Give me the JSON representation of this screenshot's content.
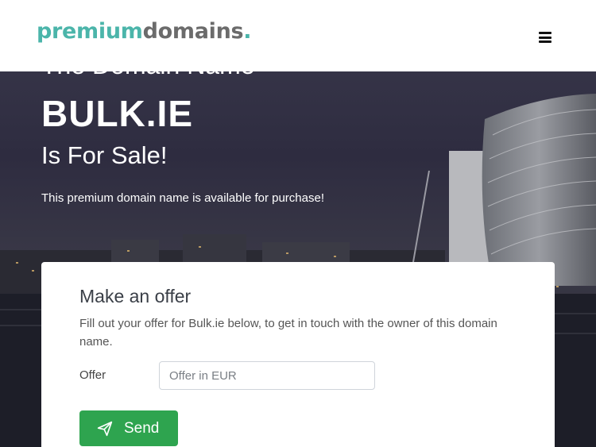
{
  "header": {
    "logo_part1": "premium",
    "logo_part2": "domains",
    "logo_dot": ".",
    "menu_icon": "hamburger-icon"
  },
  "hero": {
    "pre_title": "The Domain Name",
    "domain": "BULK.IE",
    "sale": "Is For Sale!",
    "subtitle": "This premium domain name is available for purchase!"
  },
  "offer": {
    "title": "Make an offer",
    "description": "Fill out your offer for Bulk.ie below, to get in touch with the owner of this domain name.",
    "offer_label": "Offer",
    "offer_placeholder": "Offer in EUR",
    "send_label": "Send",
    "send_icon": "paper-plane-icon"
  },
  "colors": {
    "brand_teal": "#4bb5aa",
    "brand_gray": "#6b6b6b",
    "send_green": "#2ea44f"
  }
}
